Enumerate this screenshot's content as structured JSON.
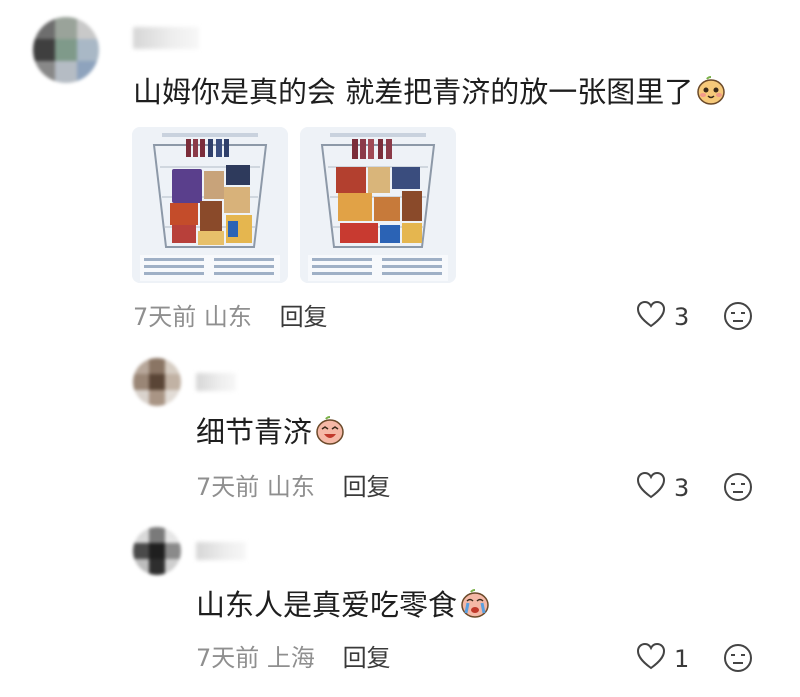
{
  "comments": [
    {
      "text": "山姆你是真的会 就差把青济的放一张图里了",
      "emoji": "shy-face-sticker",
      "time": "7天前",
      "location": "山东",
      "reply_label": "回复",
      "likes": "3",
      "images": [
        "cart-image-1",
        "cart-image-2"
      ]
    },
    {
      "text": "细节青济",
      "emoji": "laughing-face-sticker",
      "time": "7天前",
      "location": "山东",
      "reply_label": "回复",
      "likes": "3"
    },
    {
      "text": "山东人是真爱吃零食",
      "emoji": "crying-face-sticker",
      "time": "7天前",
      "location": "上海",
      "reply_label": "回复",
      "likes": "1"
    }
  ],
  "colors": {
    "text": "#1e1e1e",
    "meta": "#8f8f8f",
    "icon": "#3a3a3a",
    "sticker": "#f6c97a"
  }
}
